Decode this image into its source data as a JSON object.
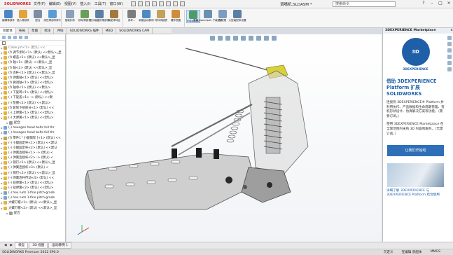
{
  "titlebar": {
    "logo": "SOLIDWORKS",
    "menus": [
      "文件(F)",
      "编辑(E)",
      "视图(V)",
      "插入(I)",
      "工具(T)",
      "窗口(W)"
    ],
    "document": "调嘴机.SLDASM *",
    "search_placeholder": "搜索命令"
  },
  "ribbon": {
    "buttons": [
      {
        "label": "编辑零部件",
        "color": "#4a86c5"
      },
      {
        "label": "插入零部件",
        "color": "#e3a23a"
      },
      {
        "label": "配合",
        "color": "#7b8ea3"
      },
      {
        "label": "线性零部件阵列",
        "color": "#5b9bd5"
      },
      {
        "label": "智能扣件",
        "color": "#8aa0b8"
      },
      {
        "label": "移动零部件",
        "color": "#6a9f5b"
      },
      {
        "label": "显示隐藏的零部件",
        "color": "#5c7fa3"
      },
      {
        "label": "装配体特征",
        "color": "#a47a3c"
      },
      {
        "label": "参考...",
        "color": "#7d7d7d"
      },
      {
        "label": "新建运动算例",
        "color": "#4c8ac0"
      },
      {
        "label": "材料明细表",
        "color": "#c2a25a"
      },
      {
        "label": "爆炸视图",
        "color": "#d08c3a"
      },
      {
        "label": "Instant3D",
        "color": "#4e9a6a"
      },
      {
        "label": "更新 Speedpak 子装配体",
        "color": "#6b8fb3"
      },
      {
        "label": "拍快照",
        "color": "#7c9cc0"
      },
      {
        "label": "大型装配体设置",
        "color": "#5a7fa6"
      }
    ]
  },
  "tabs": [
    "装配体",
    "布局",
    "草图",
    "标注",
    "评估",
    "SOLIDWORKS 插件",
    "MBD",
    "SOLIDWORKS CAM"
  ],
  "feature_tree": {
    "items": [
      {
        "label": "Cable.prt<1> (默认) <<",
        "icon": "sub",
        "gray": true
      },
      {
        "label": "(f) 调节手轮<1> (默认) <<默认>_显",
        "icon": "part"
      },
      {
        "label": "(f) 螺盖<1> (默认) <<默认>_显",
        "icon": "part"
      },
      {
        "label": "(f) 轴<1> (默认) <<默认>_显",
        "icon": "part"
      },
      {
        "label": "(f) 轴<2> (默认) <<默认>_显",
        "icon": "part"
      },
      {
        "label": "(f) 连杆<1> (默认) <<默认>_显",
        "icon": "part"
      },
      {
        "label": "(f) 弹簧轴<1> (默认) <<默认>",
        "icon": "part"
      },
      {
        "label": "(f) 微调轴<1> (默认) <<默认>",
        "icon": "part"
      },
      {
        "label": "(f) 轴承<1> (默认) <<默认>",
        "icon": "part"
      },
      {
        "label": "(-) 下旋转<1> (默认) <<默认>",
        "icon": "part"
      },
      {
        "label": "(-) 下旋盖<1> -> (默认) <<默",
        "icon": "part"
      },
      {
        "label": "(-) 垫圈<1> (默认) <<默认>",
        "icon": "part"
      },
      {
        "label": "(f) 套筒下部部分<1> (默认) <<",
        "icon": "part"
      },
      {
        "label": "(-) 上弹簧<1> (默认) <<默认>",
        "icon": "part"
      },
      {
        "label": "(-) 大弹簧<1> (默认) <<默认>",
        "icon": "part"
      },
      {
        "label": "配合",
        "icon": "mate",
        "indent": true
      },
      {
        "label": "(-) hexagon head bolts full thr",
        "icon": "asm"
      },
      {
        "label": "(-) hexagon head bolts full thr",
        "icon": "asm"
      },
      {
        "label": "(f) 零件1^小腿钢架 [+1> (默认) <<",
        "icon": "sub"
      },
      {
        "label": "(-) 小腿固定杆<1> (默认) <<默认",
        "icon": "part"
      },
      {
        "label": "(-) 小腿固定杆<2> (默认) <<默认",
        "icon": "part"
      },
      {
        "label": "(-) 弹簧连接杆<1> -> (默认) <",
        "icon": "part"
      },
      {
        "label": "(-) 弹簧连接杆<2> -> (默认) <",
        "icon": "part"
      },
      {
        "label": "(-) 销钉<1> (默认) <<默认>_显",
        "icon": "part"
      },
      {
        "label": "(-) 弹簧连接杆<3> (默认) <",
        "icon": "part"
      },
      {
        "label": "(-) 销钉<2> (默认) <<默认>_显",
        "icon": "part"
      },
      {
        "label": "(-) 弹簧连杆传动<4> (默认) <<",
        "icon": "part"
      },
      {
        "label": "(-) 短弹簧<1> (默认) <<默认>",
        "icon": "part"
      },
      {
        "label": "(-) 短弹簧<2> (默认) <<默认>",
        "icon": "part"
      },
      {
        "label": "(-) hex nuts 1-fine pitch-grade",
        "icon": "asm"
      },
      {
        "label": "(-) hex nuts 1-fine pitch-grade",
        "icon": "asm"
      },
      {
        "label": "大螺钉帽<1> (默认) <<默认>_显",
        "icon": "part"
      },
      {
        "label": "大螺钉帽<2> (默认) <<默认>_显",
        "icon": "part"
      },
      {
        "label": "配合",
        "icon": "mate",
        "indent": true
      }
    ]
  },
  "taskpane": {
    "title": "3DEXPERIENCE Marketplace",
    "logo_text": "3D",
    "logo_sub": "V,R",
    "brand": "3DEXPERIENCE",
    "headline": "借助 3DEXPERIENCE Platform 扩展 SOLIDWORKS",
    "para1": "连接到 3DEXPERIENCE® Platform 并利用协作、产品数据和生命周期管理、有机形状设计、仿真解决方案等功能。（需要订阅。）",
    "para2": "使用 3DEXPERIENCE Marketplace 在全球范围内采购 3D 内容和服务。（无需订阅。）",
    "button": "让我们开始吧",
    "footer": "详细了解 3DEXPERIENCE 与 3DEXPERIENCE Platform 结合使用"
  },
  "bottom_tabs": [
    "模型",
    "3D 视图",
    "运动算例 1"
  ],
  "status": {
    "app": "SOLIDWORKS Premium 2022 SP0.0",
    "state": "欠定义",
    "mode": "在编辑 装配体",
    "units": "MMGS"
  }
}
